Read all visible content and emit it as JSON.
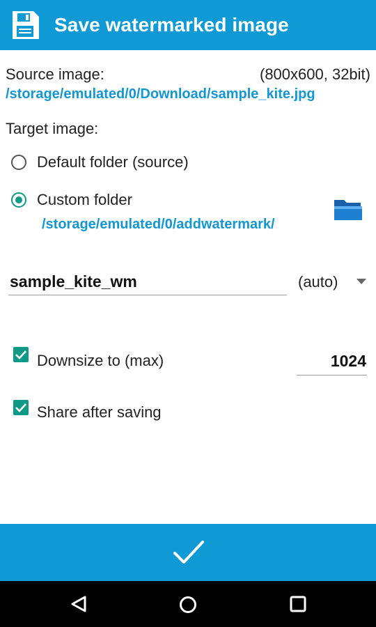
{
  "header": {
    "title": "Save watermarked image",
    "icon": "save-floppy-icon",
    "accent_color": "#0f9ad6"
  },
  "source": {
    "label": "Source image:",
    "info": "(800x600, 32bit)",
    "path": "/storage/emulated/0/Download/sample_kite.jpg"
  },
  "target": {
    "label": "Target image:",
    "options": [
      {
        "label": "Default folder (source)",
        "selected": false
      },
      {
        "label": "Custom folder",
        "selected": true
      }
    ],
    "custom_path": "/storage/emulated/0/addwatermark/",
    "folder_icon": "folder-icon"
  },
  "filename": {
    "value": "sample_kite_wm",
    "format": "(auto)"
  },
  "options": {
    "downsize_label": "Downsize to (max)",
    "downsize_checked": true,
    "downsize_value": "1024",
    "share_label": "Share after saving",
    "share_checked": true
  },
  "action": {
    "icon": "checkmark-icon"
  },
  "navbar": {
    "icons": [
      "back-icon",
      "home-icon",
      "recents-icon"
    ]
  }
}
